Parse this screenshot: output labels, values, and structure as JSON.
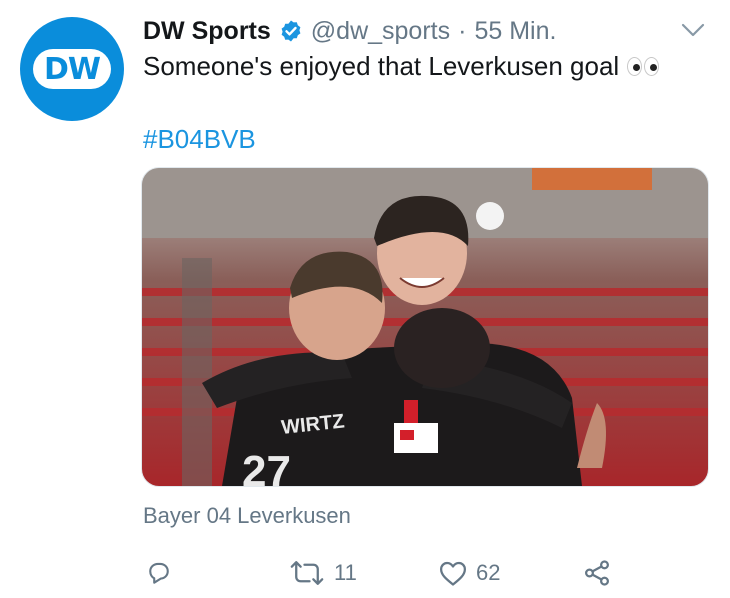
{
  "tweet": {
    "author_name": "DW Sports",
    "avatar_text": "DW",
    "handle": "@dw_sports",
    "separator": "·",
    "time": "55 Min.",
    "text": "Someone's enjoyed that Leverkusen goal",
    "hashtag": "#B04BVB",
    "jersey_text": "WIRTZ",
    "location": "Bayer 04 Leverkusen"
  },
  "actions": {
    "retweets": "11",
    "likes": "62"
  },
  "colors": {
    "brand_blue": "#0a8ddb",
    "link_blue": "#1b95e0",
    "muted_gray": "#657786",
    "text_dark": "#14171a"
  },
  "icons": [
    "verified-badge-icon",
    "chevron-down-icon",
    "eyes-emoji-icon",
    "reply-icon",
    "retweet-icon",
    "like-icon",
    "share-icon"
  ]
}
